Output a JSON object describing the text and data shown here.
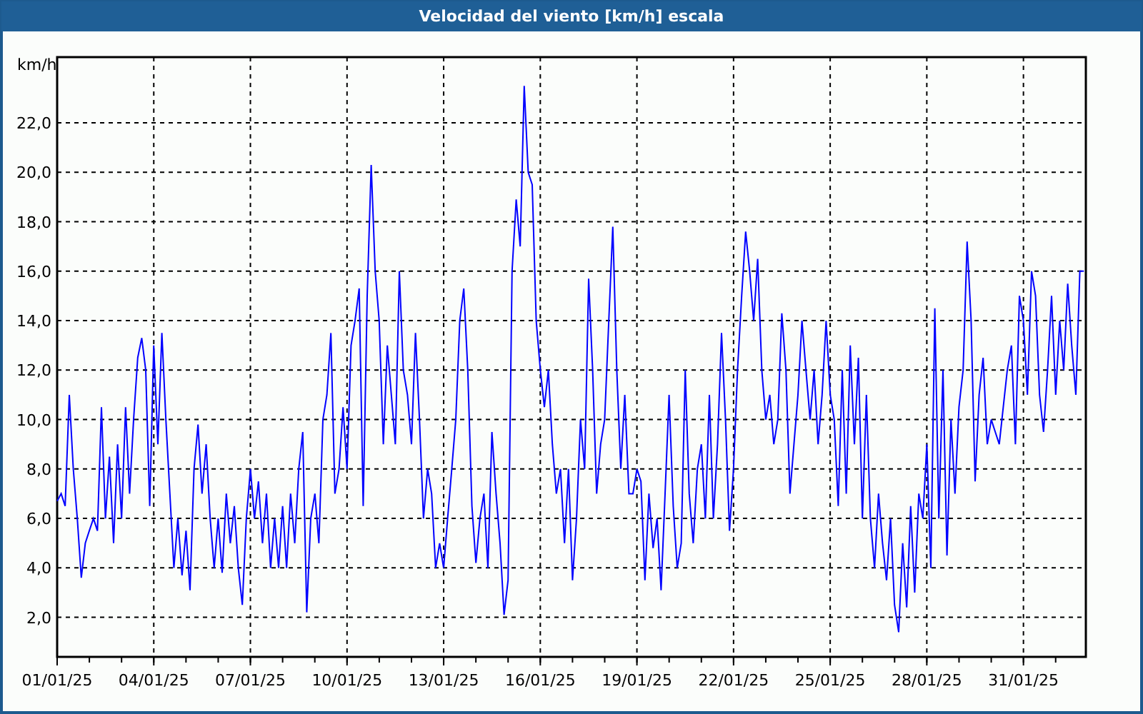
{
  "window": {
    "title": "Velocidad del viento [km/h] escala"
  },
  "chart": {
    "chart_data": {
      "type": "line",
      "ylabel": "km/h",
      "grid": true,
      "ylim": [
        0.4,
        24.66
      ],
      "yticks": [
        {
          "value": 2,
          "label": "2,0"
        },
        {
          "value": 4,
          "label": "4,0"
        },
        {
          "value": 6,
          "label": "6,0"
        },
        {
          "value": 8,
          "label": "8,0"
        },
        {
          "value": 10,
          "label": "10,0"
        },
        {
          "value": 12,
          "label": "12,0"
        },
        {
          "value": 14,
          "label": "14,0"
        },
        {
          "value": 16,
          "label": "16,0"
        },
        {
          "value": 18,
          "label": "18,0"
        },
        {
          "value": 20,
          "label": "20,0"
        },
        {
          "value": 22,
          "label": "22,0"
        }
      ],
      "categories": [
        "01/01/25",
        null,
        null,
        null,
        null,
        null,
        null,
        null,
        null,
        null,
        null,
        null,
        null,
        null,
        null,
        null,
        null,
        null,
        null,
        null,
        null,
        null,
        null,
        null,
        "04/01/25",
        null,
        null,
        null,
        null,
        null,
        null,
        null,
        null,
        null,
        null,
        null,
        null,
        null,
        null,
        null,
        null,
        null,
        null,
        null,
        null,
        null,
        null,
        null,
        "07/01/25",
        null,
        null,
        null,
        null,
        null,
        null,
        null,
        null,
        null,
        null,
        null,
        null,
        null,
        null,
        null,
        null,
        null,
        null,
        null,
        null,
        null,
        null,
        null,
        "10/01/25",
        null,
        null,
        null,
        null,
        null,
        null,
        null,
        null,
        null,
        null,
        null,
        null,
        null,
        null,
        null,
        null,
        null,
        null,
        null,
        null,
        null,
        null,
        null,
        "13/01/25",
        null,
        null,
        null,
        null,
        null,
        null,
        null,
        null,
        null,
        null,
        null,
        null,
        null,
        null,
        null,
        null,
        null,
        null,
        null,
        null,
        null,
        null,
        null,
        "16/01/25",
        null,
        null,
        null,
        null,
        null,
        null,
        null,
        null,
        null,
        null,
        null,
        null,
        null,
        null,
        null,
        null,
        null,
        null,
        null,
        null,
        null,
        null,
        null,
        "19/01/25",
        null,
        null,
        null,
        null,
        null,
        null,
        null,
        null,
        null,
        null,
        null,
        null,
        null,
        null,
        null,
        null,
        null,
        null,
        null,
        null,
        null,
        null,
        null,
        "22/01/25",
        null,
        null,
        null,
        null,
        null,
        null,
        null,
        null,
        null,
        null,
        null,
        null,
        null,
        null,
        null,
        null,
        null,
        null,
        null,
        null,
        null,
        null,
        null,
        "25/01/25",
        null,
        null,
        null,
        null,
        null,
        null,
        null,
        null,
        null,
        null,
        null,
        null,
        null,
        null,
        null,
        null,
        null,
        null,
        null,
        null,
        null,
        null,
        null,
        "28/01/25",
        null,
        null,
        null,
        null,
        null,
        null,
        null,
        null,
        null,
        null,
        null,
        null,
        null,
        null,
        null,
        null,
        null,
        null,
        null,
        null,
        null,
        null,
        null,
        "31/01/25",
        null,
        null,
        null,
        null,
        null,
        null,
        null,
        null,
        null,
        null,
        null,
        null,
        null,
        null,
        null
      ],
      "series": [
        {
          "color": "#0000ff",
          "values": [
            6.7,
            7,
            6.5,
            11,
            8,
            6,
            3.6,
            5,
            5.5,
            6,
            5.5,
            10.5,
            6,
            8.5,
            5,
            9,
            6,
            10.5,
            7,
            10,
            12.5,
            13.3,
            12,
            6.5,
            13,
            9,
            13.5,
            10,
            7,
            4,
            6,
            3.7,
            5.5,
            3.1,
            8,
            9.8,
            7,
            9,
            6,
            4,
            6,
            3.8,
            7,
            5,
            6.5,
            4,
            2.5,
            6,
            8,
            6,
            7.5,
            5,
            7,
            4,
            6,
            4,
            6.5,
            4,
            7,
            5,
            8,
            9.5,
            2.2,
            6,
            7,
            5,
            10,
            11,
            13.5,
            7,
            8,
            10.5,
            8,
            13,
            14,
            15.3,
            6.5,
            15,
            20.3,
            16,
            14,
            9,
            13,
            11,
            9,
            16,
            12,
            11,
            9,
            13.5,
            10,
            6,
            8,
            7,
            4,
            5,
            4,
            6,
            8,
            10,
            14,
            15.3,
            12,
            6.5,
            4.2,
            6,
            7,
            4,
            9.5,
            7,
            5,
            2.1,
            3.5,
            16,
            18.9,
            17,
            23.5,
            20,
            19.5,
            14,
            12,
            10.5,
            12,
            9,
            7,
            8,
            5,
            8,
            3.5,
            6,
            10,
            8,
            15.7,
            12,
            7,
            9,
            10,
            14,
            17.8,
            12,
            8,
            11,
            7,
            7,
            8,
            7.5,
            3.5,
            7,
            4.8,
            6,
            3.1,
            7,
            11,
            6.5,
            4,
            5,
            12,
            7,
            5,
            8,
            9,
            6,
            11,
            6,
            9,
            13.5,
            10,
            5.5,
            8,
            12,
            15,
            17.6,
            16,
            14,
            16.5,
            12,
            10,
            11,
            9,
            10,
            14.3,
            12,
            7,
            9,
            11,
            14,
            12,
            10,
            12,
            9,
            11,
            14,
            11,
            10,
            6.5,
            12,
            7,
            13,
            9,
            12.5,
            6,
            11,
            6,
            4,
            7,
            5,
            3.5,
            6,
            2.5,
            1.4,
            5,
            2.4,
            6.5,
            3,
            7,
            6,
            9,
            4,
            14.5,
            6,
            12,
            4.5,
            10,
            7,
            10.5,
            12,
            17.2,
            14,
            7.5,
            11,
            12.5,
            9,
            10,
            9.5,
            9,
            10.5,
            12,
            13,
            9,
            15,
            14,
            11,
            16,
            15,
            11,
            9.5,
            12,
            15,
            11,
            14,
            12,
            15.5,
            13,
            11,
            16,
            16
          ]
        }
      ]
    }
  }
}
